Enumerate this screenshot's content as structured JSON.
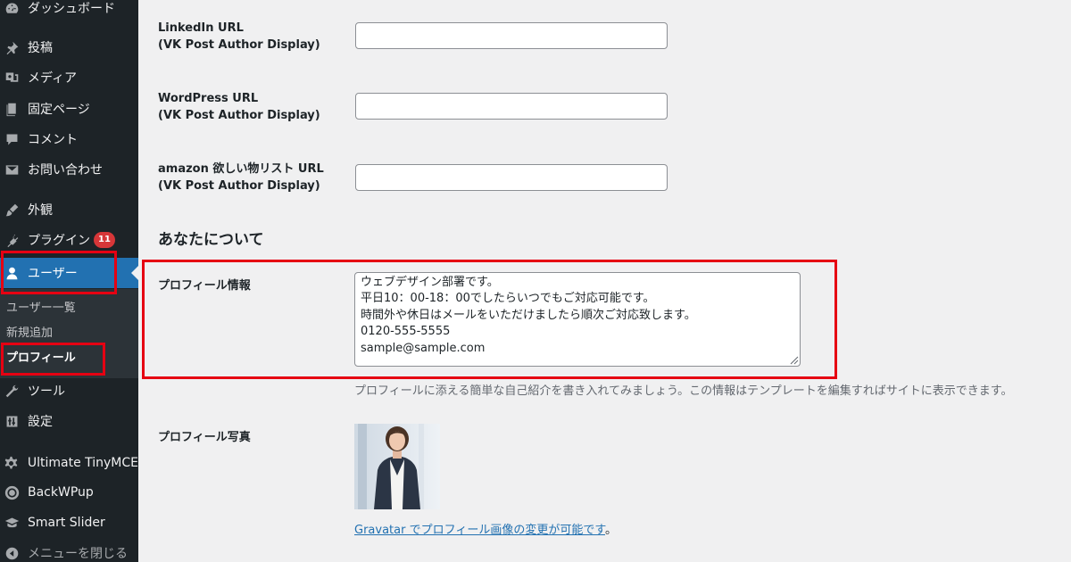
{
  "sidebar": {
    "items": [
      {
        "label": "ダッシュボード",
        "icon": "dashboard-icon"
      },
      {
        "label": "投稿",
        "icon": "pin-icon"
      },
      {
        "label": "メディア",
        "icon": "media-icon"
      },
      {
        "label": "固定ページ",
        "icon": "page-icon"
      },
      {
        "label": "コメント",
        "icon": "comment-icon"
      },
      {
        "label": "お問い合わせ",
        "icon": "mail-icon"
      },
      {
        "label": "外観",
        "icon": "brush-icon"
      },
      {
        "label": "プラグイン",
        "icon": "plugin-icon",
        "badge": "11"
      },
      {
        "label": "ユーザー",
        "icon": "user-icon",
        "current": true
      },
      {
        "label": "ツール",
        "icon": "wrench-icon"
      },
      {
        "label": "設定",
        "icon": "settings-icon"
      },
      {
        "label": "Ultimate TinyMCE",
        "icon": "gear-icon"
      },
      {
        "label": "BackWPup",
        "icon": "backwpup-icon"
      },
      {
        "label": "Smart Slider",
        "icon": "graduation-cap-icon"
      },
      {
        "label": "メニューを閉じる",
        "icon": "collapse-icon"
      }
    ],
    "submenu": [
      {
        "label": "ユーザー一覧"
      },
      {
        "label": "新規追加"
      },
      {
        "label": "プロフィール",
        "active": true
      }
    ]
  },
  "fields": {
    "linkedin": {
      "label": "LinkedIn URL",
      "sub": "(VK Post Author Display)",
      "value": ""
    },
    "wordpress": {
      "label": "WordPress URL",
      "sub": "(VK Post Author Display)",
      "value": ""
    },
    "amazon": {
      "label": "amazon 欲しい物リスト URL",
      "sub": "(VK Post Author Display)",
      "value": ""
    }
  },
  "about": {
    "heading": "あなたについて",
    "bio_label": "プロフィール情報",
    "bio_value": "ウェブデザイン部署です。\n平日10：00-18：00でしたらいつでもご対応可能です。\n時間外や休日はメールをいただけましたら順次ご対応致します。\n0120-555-5555\nsample@sample.com",
    "bio_description": "プロフィールに添える簡単な自己紹介を書き入れてみましょう。この情報はテンプレートを編集すればサイトに表示できます。",
    "photo_label": "プロフィール写真",
    "gravatar_link": "Gravatar でプロフィール画像の変更が可能です",
    "gravatar_suffix": "。"
  },
  "colors": {
    "sidebar_bg": "#1d2327",
    "accent": "#2271b1",
    "highlight_box": "#e60012",
    "badge": "#d63638"
  }
}
